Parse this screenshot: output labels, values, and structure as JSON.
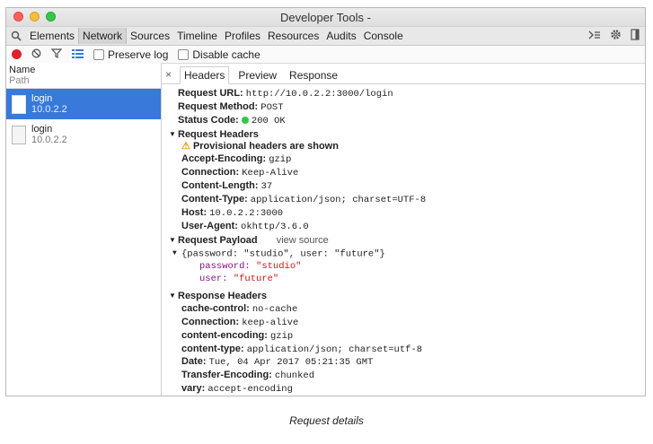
{
  "window": {
    "title": "Developer Tools -"
  },
  "devtools_tabs": [
    "Elements",
    "Network",
    "Sources",
    "Timeline",
    "Profiles",
    "Resources",
    "Audits",
    "Console"
  ],
  "toolbar": {
    "preserve_log": "Preserve log",
    "disable_cache": "Disable cache"
  },
  "list": {
    "header_name": "Name",
    "header_path": "Path",
    "items": [
      {
        "name": "login",
        "host": "10.0.2.2"
      },
      {
        "name": "login",
        "host": "10.0.2.2"
      }
    ]
  },
  "detail_tabs": {
    "close": "×",
    "headers": "Headers",
    "preview": "Preview",
    "response": "Response"
  },
  "general": {
    "url_key": "Request URL:",
    "url_val": "http://10.0.2.2:3000/login",
    "method_key": "Request Method:",
    "method_val": "POST",
    "status_key": "Status Code:",
    "status_val": "200 OK"
  },
  "request_headers": {
    "title": "Request Headers",
    "warning": "Provisional headers are shown",
    "items": [
      {
        "k": "Accept-Encoding:",
        "v": "gzip"
      },
      {
        "k": "Connection:",
        "v": "Keep-Alive"
      },
      {
        "k": "Content-Length:",
        "v": "37"
      },
      {
        "k": "Content-Type:",
        "v": "application/json; charset=UTF-8"
      },
      {
        "k": "Host:",
        "v": "10.0.2.2:3000"
      },
      {
        "k": "User-Agent:",
        "v": "okhttp/3.6.0"
      }
    ]
  },
  "payload": {
    "title": "Request Payload",
    "view_source": "view source",
    "summary": "{password: \"studio\", user: \"future\"}",
    "fields": [
      {
        "k": "password:",
        "v": "\"studio\""
      },
      {
        "k": "user:",
        "v": "\"future\""
      }
    ]
  },
  "response_headers": {
    "title": "Response Headers",
    "items": [
      {
        "k": "cache-control:",
        "v": "no-cache"
      },
      {
        "k": "Connection:",
        "v": "keep-alive"
      },
      {
        "k": "content-encoding:",
        "v": "gzip"
      },
      {
        "k": "content-type:",
        "v": "application/json; charset=utf-8"
      },
      {
        "k": "Date:",
        "v": "Tue, 04 Apr 2017 05:21:35 GMT"
      },
      {
        "k": "Transfer-Encoding:",
        "v": "chunked"
      },
      {
        "k": "vary:",
        "v": "accept-encoding"
      }
    ]
  },
  "caption": "Request details",
  "colors": {
    "selected": "#3879d9",
    "record": "#e0212a",
    "status_ok": "#2ec84a"
  },
  "icons": [
    "search-icon",
    "record-icon",
    "clear-icon",
    "filter-icon",
    "list-view-icon",
    "drawer-icon",
    "gear-icon",
    "dock-icon",
    "file-icon",
    "warning-icon",
    "triangle-down-icon"
  ]
}
